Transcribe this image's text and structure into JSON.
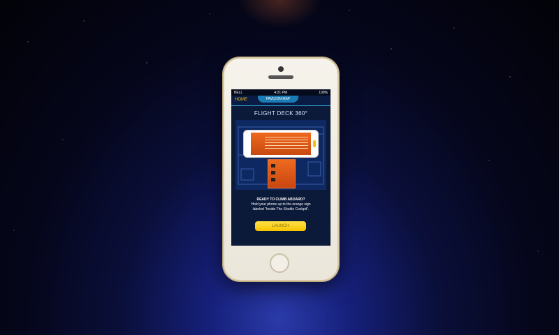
{
  "statusbar": {
    "carrier": "BELL",
    "time": "4:21 PM",
    "battery": "100%"
  },
  "nav": {
    "home_label": "HOME",
    "tab_label": "PAVILION MAP"
  },
  "screen": {
    "title": "FLIGHT DECK 360°"
  },
  "prompt": {
    "heading": "READY TO CLIMB ABOARD?",
    "line1": "Hold your phone up to the orange sign",
    "line2": "labeled \"Inside The Shuttle Cockpit\"."
  },
  "launch_label": "LAUNCH",
  "icons": [
    "wifi-icon",
    "battery-icon",
    "phone-rotate-icon"
  ],
  "colors": {
    "accent": "#f5c400",
    "bg_top": "#05061a",
    "bg_glow": "#2a3aa8",
    "sign": "#ee6a20",
    "nav": "#1b7cb5"
  }
}
